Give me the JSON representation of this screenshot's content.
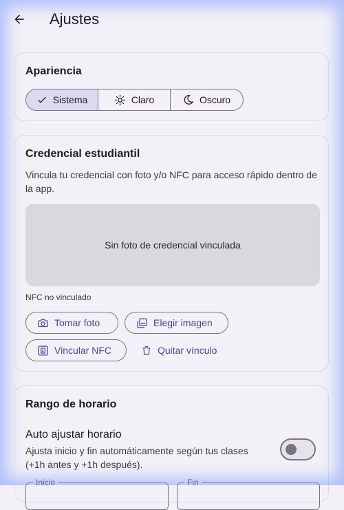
{
  "appbar": {
    "title": "Ajustes",
    "back_icon": "arrow-back-icon"
  },
  "appearance": {
    "title": "Apariencia",
    "options": [
      {
        "label": "Sistema",
        "icon": "check-icon",
        "selected": true
      },
      {
        "label": "Claro",
        "icon": "sun-icon",
        "selected": false
      },
      {
        "label": "Oscuro",
        "icon": "moon-icon",
        "selected": false
      }
    ]
  },
  "credential": {
    "title": "Credencial estudiantil",
    "description": "Vincula tu credencial con foto y/o NFC para acceso rápido dentro de la app.",
    "photo_placeholder": "Sin foto de credencial vinculada",
    "nfc_status": "NFC no vinculado",
    "take_photo": "Tomar foto",
    "choose_image": "Elegir imagen",
    "link_nfc": "Vincular NFC",
    "unlink": "Quitar vínculo"
  },
  "schedule": {
    "title": "Rango de horario",
    "auto_title": "Auto ajustar horario",
    "auto_desc": "Ajusta inicio y fin automáticamente según tus clases (+1h antes y +1h después).",
    "auto_enabled": false,
    "start_label": "Inicio",
    "end_label": "Fin"
  },
  "colors": {
    "accent": "#4a4690",
    "selected_bg": "#dcd9f2",
    "background": "#f3f1f7"
  }
}
